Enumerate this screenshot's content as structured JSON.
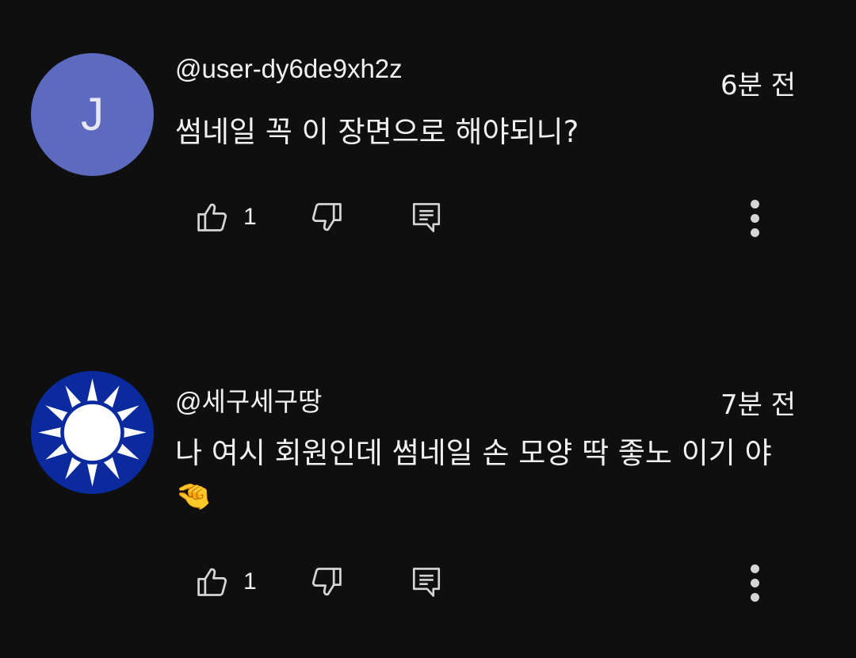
{
  "comments": [
    {
      "author": "@user-dy6de9xh2z",
      "time": "6분 전",
      "text": "썸네일 꼭 이 장면으로 해야되니?",
      "avatar_letter": "J",
      "avatar_color": "#5c6bc0",
      "likes": "1",
      "icons": {
        "like": "thumbs-up-icon",
        "dislike": "thumbs-down-icon",
        "reply": "reply-icon",
        "more": "more-vert-icon"
      }
    },
    {
      "author": "@세구세구땅",
      "time": "7분 전",
      "text": "나 여시 회원인데 썸네일 손 모양 딱 좋노 이기 야 🤏",
      "avatar_style": "blue-sky-white-sun",
      "likes": "1",
      "icons": {
        "like": "thumbs-up-icon",
        "dislike": "thumbs-down-icon",
        "reply": "reply-icon",
        "more": "more-vert-icon"
      }
    }
  ],
  "colors": {
    "background": "#0f0f0f",
    "text": "#f1f1f1",
    "icon": "#d5d5d5"
  }
}
